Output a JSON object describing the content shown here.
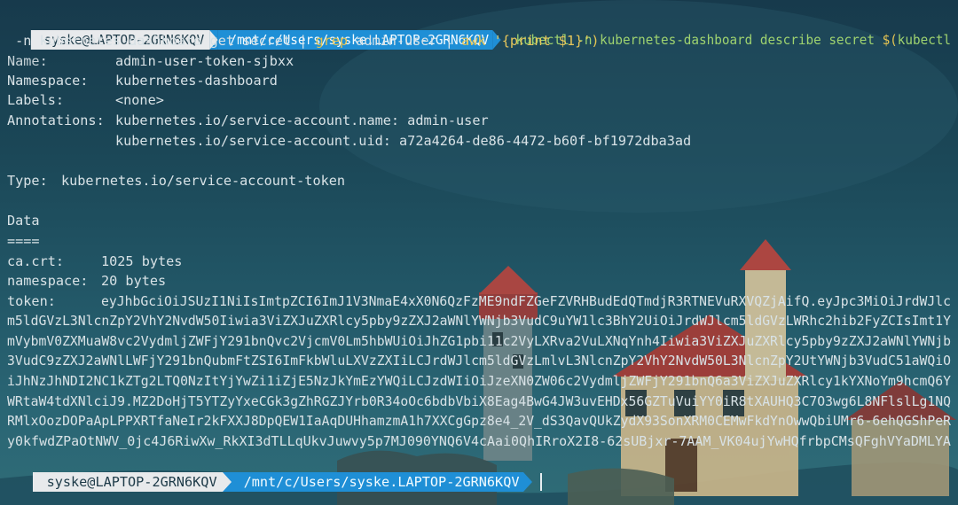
{
  "prompt": {
    "user_host": "syske@LAPTOP-2GRN6KQV",
    "path": "/mnt/c/Users/syske.LAPTOP-2GRN6KQV"
  },
  "command": {
    "line1_prefix": "kubectl -n kubernetes-dashboard describe secret ",
    "subst_open": "$(",
    "line1_tail": "kubectl",
    "line2_part1": " -n kubernetes-dashboard get secret | ",
    "grep": "grep",
    "line2_part2": " admin-user | ",
    "awk": "awk",
    "awk_arg": " '{print $1}'",
    "subst_close": ")"
  },
  "output": {
    "name_key": "Name:",
    "name_val": "admin-user-token-sjbxx",
    "namespace_key": "Namespace:",
    "namespace_val": "kubernetes-dashboard",
    "labels_key": "Labels:",
    "labels_val": "<none>",
    "annotations_key": "Annotations:",
    "annotation_1": "kubernetes.io/service-account.name: admin-user",
    "annotation_2": "kubernetes.io/service-account.uid: a72a4264-de86-4472-b60f-bf1972dba3ad",
    "type_key": "Type:",
    "type_val": "kubernetes.io/service-account-token",
    "data_heading": "Data",
    "data_rule": "====",
    "cacrt_key": "ca.crt:",
    "cacrt_val": "1025 bytes",
    "ns_key": "namespace:",
    "ns_val": "20 bytes",
    "token_key": "token:",
    "token_lines": [
      "eyJhbGciOiJSUzI1NiIsImtpZCI6ImJ1V3NmaE4xX0N6QzFzME9ndFZGeFZVRHBudEdQTmdjR3RTNEVuRXVQZjAifQ.eyJpc3MiOiJrdWJlc",
      "m5ldGVzL3NlcnZpY2VhY2NvdW50Iiwia3ViZXJuZXRlcy5pby9zZXJ2aWNlYWNjb3VudC9uYW1lc3BhY2UiOiJrdWJlcm5ldGVzLWRhc2hib2FyZCIsImt1Y",
      "mVybmV0ZXMuaW8vc2VydmljZWFjY291bnQvc2VjcmV0Lm5hbWUiOiJhZG1pbi11c2VyLXRva2VuLXNqYnh4Iiwia3ViZXJuZXRlcy5pby9zZXJ2aWNlYWNjb",
      "3VudC9zZXJ2aWNlLWFjY291bnQubmFtZSI6ImFkbWluLXVzZXIiLCJrdWJlcm5ldGVzLmlvL3NlcnZpY2VhY2NvdW50L3NlcnZpY2UtYWNjb3VudC51aWQiO",
      "iJhNzJhNDI2NC1kZTg2LTQ0NzItYjYwZi1iZjE5NzJkYmEzYWQiLCJzdWIiOiJzeXN0ZW06c2VydmljZWFjY291bnQ6a3ViZXJuZXRlcy1kYXNoYm9hcmQ6Y",
      "WRtaW4tdXNlciJ9.MZ2DoHjT5YTZyYxeCGk3gZhRGZJYrb0R34oOc6bdbVbiX8Eag4BwG4JW3uvEHDx56GZTuVuiYY0iR8tXAUHQ3C7O3wg6L8NFlslLg1NQ",
      "RMlxOozDOPaApLPPXRTfaNeIr2kFXXJ8DpQEW1IaAqDUHhamzmA1h7XXCgGpz8e4_2V_dS3QavQUkZydX93SonXRM0CEMwFkdYnOwwQbiUMr6-6ehQGShPeR",
      "y0kfwdZPaOtNWV_0jc4J6RiwXw_RkXI3dTLLqUkvJuwvy5p7MJ090YNQ6V4cAai0QhIRroX2I8-62sUBjxr-7AAM_VK04ujYwHQfrbpCMsQFghVYaDMLYA"
    ]
  },
  "colors": {
    "prompt_user_bg": "#e8eaec",
    "prompt_path_bg": "#1f8fd6",
    "command_keyword": "#9fd36f",
    "pipe_commands": "#e5c452"
  }
}
